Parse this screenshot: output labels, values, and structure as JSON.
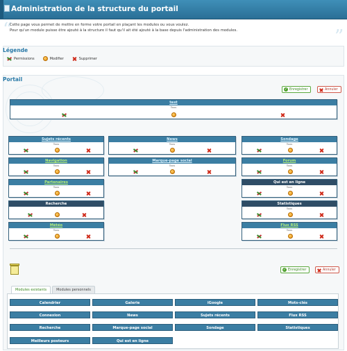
{
  "header": {
    "title": "Administration de la structure du portail",
    "intro_line1": "Cette page vous permet de mettre en forme votre portail en plaçant les modules ou vous voulez.",
    "intro_line2": "Pour qu'un module puisse être ajouté à la structure il faut qu'il ait été ajouté à la base depuis l'administration des modules."
  },
  "legend": {
    "title": "Légende",
    "permissions": "Permissions",
    "modify": "Modifier",
    "delete": "Supprimer"
  },
  "portal": {
    "title": "Portail",
    "save_label": "Enregistrer",
    "cancel_label": "Annuler",
    "top_module": {
      "title": "test",
      "sub": "Tous"
    },
    "left_modules": [
      {
        "title": "Sujets récents",
        "sub": "Tous"
      },
      {
        "title": "Navigation",
        "sub": "Tous"
      },
      {
        "title": "Partenaires",
        "sub": "Tous"
      },
      {
        "title": "Recherche",
        "sub": ""
      },
      {
        "title": "Météo",
        "sub": "Tous"
      }
    ],
    "center_modules": [
      {
        "title": "News",
        "sub": "Tous"
      },
      {
        "title": "Marque-page social",
        "sub": "Tous"
      }
    ],
    "right_modules": [
      {
        "title": "Sondage",
        "sub": "Tous"
      },
      {
        "title": "Forum",
        "sub": "Tous"
      },
      {
        "title": "Qui est en ligne",
        "sub": "Tous"
      },
      {
        "title": "Statistiques",
        "sub": "Tous"
      },
      {
        "title": "Flux RSS",
        "sub": "Tous"
      }
    ]
  },
  "bottom": {
    "save_label": "Enregistrer",
    "cancel_label": "Annuler",
    "tabs": [
      {
        "label": "Modules existants"
      },
      {
        "label": "Modules personnels"
      }
    ],
    "available_modules": [
      "Calendrier",
      "Galerie",
      "iGoogle",
      "Mots-clés",
      "Connexion",
      "News",
      "Sujets récents",
      "Flux RSS",
      "Recherche",
      "Marque-page social",
      "Sondage",
      "Statistiques",
      "Meilleurs posteurs",
      "Qui est en ligne"
    ]
  },
  "colors": {
    "banner": "#2f7fab",
    "module_header": "#3b7ea3",
    "section_title": "#2a7aa8",
    "save_green": "#3d8a22",
    "cancel_red": "#b03a2c"
  },
  "icons": {
    "permissions": "permissions-icon",
    "modify": "modify-icon",
    "delete": "delete-icon"
  }
}
